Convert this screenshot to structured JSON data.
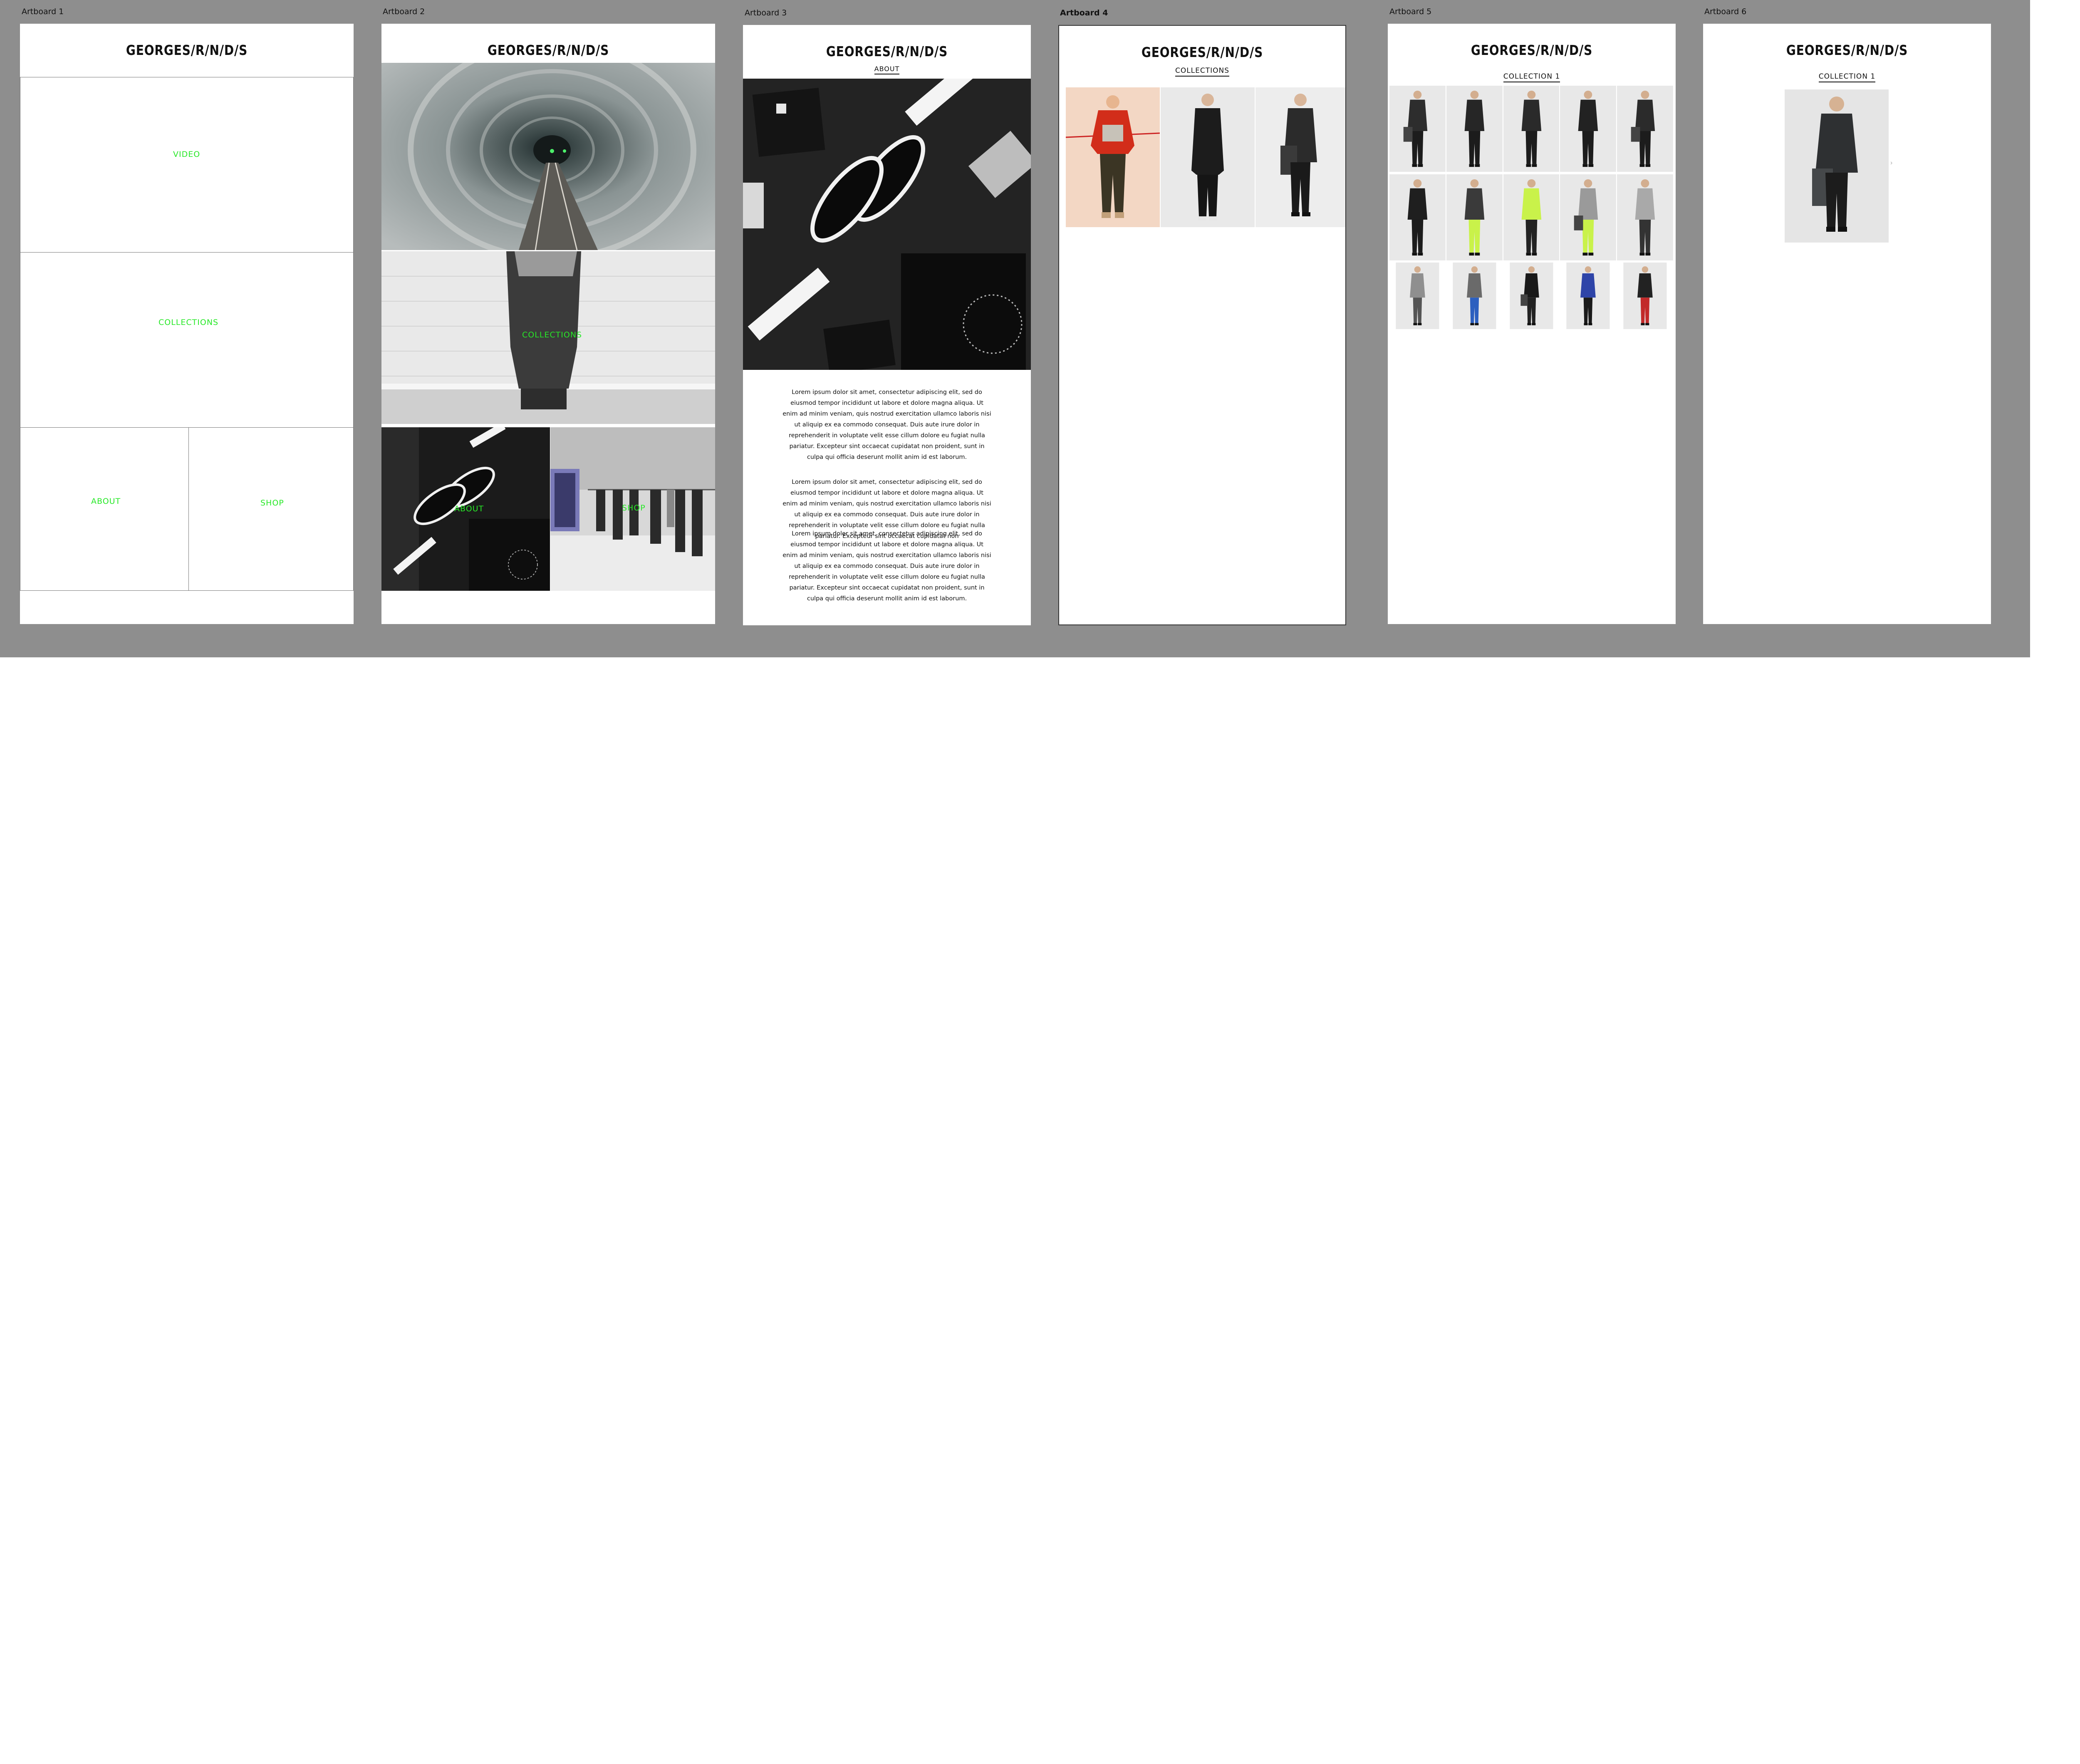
{
  "brand": "GEORGES/R/N/D/S",
  "artboards": {
    "a1": {
      "label": "Artboard 1",
      "video": "VIDEO",
      "collections": "COLLECTIONS",
      "about": "ABOUT",
      "shop": "SHOP"
    },
    "a2": {
      "label": "Artboard 2",
      "collections": "COLLECTIONS",
      "about": "ABOUT",
      "shop": "SHOP"
    },
    "a3": {
      "label": "Artboard 3",
      "heading": "ABOUT",
      "paragraphs": [
        "Lorem ipsum dolor sit amet, consectetur adipiscing elit, sed do eiusmod tempor incididunt ut labore et dolore magna aliqua. Ut enim ad minim veniam, quis nostrud exercitation ullamco laboris nisi ut aliquip ex ea commodo consequat. Duis aute irure dolor in reprehenderit in voluptate velit esse cillum dolore eu fugiat nulla pariatur. Excepteur sint occaecat cupidatat non proident, sunt in culpa qui officia deserunt mollit anim id est laborum.",
        "Lorem ipsum dolor sit amet, consectetur adipiscing elit, sed do eiusmod tempor incididunt ut labore et dolore magna aliqua. Ut enim ad minim veniam, quis nostrud exercitation ullamco laboris nisi ut aliquip ex ea commodo consequat. Duis aute irure dolor in reprehenderit in voluptate velit esse cillum dolore eu fugiat nulla pariatur. Excepteur sint occaecat cupidatat non",
        "Lorem ipsum dolor sit amet, consectetur adipiscing elit, sed do eiusmod tempor incididunt ut labore et dolore magna aliqua. Ut enim ad minim veniam, quis nostrud exercitation ullamco laboris nisi ut aliquip ex ea commodo consequat. Duis aute irure dolor in reprehenderit in voluptate velit esse cillum dolore eu fugiat nulla pariatur. Excepteur sint occaecat cupidatat non proident, sunt in culpa qui officia deserunt mollit anim id est laborum."
      ]
    },
    "a4": {
      "label": "Artboard 4",
      "heading": "COLLECTIONS"
    },
    "a5": {
      "label": "Artboard 5",
      "heading": "COLLECTION 1"
    },
    "a6": {
      "label": "Artboard 6",
      "heading": "COLLECTION 1"
    }
  },
  "colors": {
    "canvas": "#8e8e8e",
    "placeholder_text": "#27e827",
    "board": "#ffffff"
  }
}
